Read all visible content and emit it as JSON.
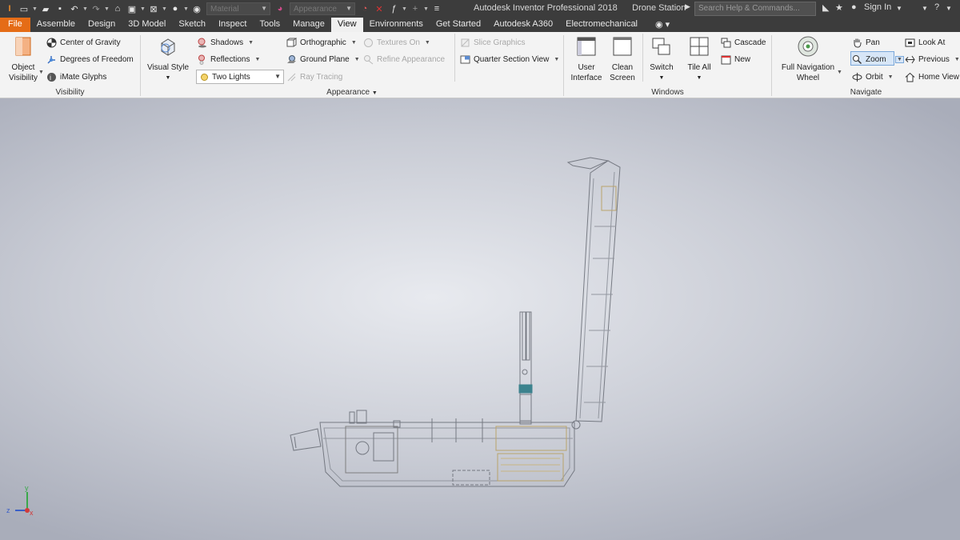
{
  "app": {
    "title": "Autodesk Inventor Professional 2018",
    "document": "Drone Station"
  },
  "qat": {
    "material_placeholder": "Material",
    "appearance_placeholder": "Appearance"
  },
  "search": {
    "placeholder": "Search Help & Commands..."
  },
  "user": {
    "sign_in": "Sign In"
  },
  "tabs": [
    "File",
    "Assemble",
    "Design",
    "3D Model",
    "Sketch",
    "Inspect",
    "Tools",
    "Manage",
    "View",
    "Environments",
    "Get Started",
    "Autodesk A360",
    "Electromechanical"
  ],
  "active_tab": "View",
  "panels": {
    "visibility": {
      "title": "Visibility",
      "object_visibility": "Object\nVisibility",
      "object_visibility_l1": "Object",
      "object_visibility_l2": "Visibility",
      "center_of_gravity": "Center of Gravity",
      "degrees_of_freedom": "Degrees of Freedom",
      "imate_glyphs": "iMate Glyphs"
    },
    "appearance": {
      "title": "Appearance",
      "visual_style": "Visual Style",
      "shadows": "Shadows",
      "reflections": "Reflections",
      "lighting": "Two Lights",
      "orthographic": "Orthographic",
      "ground_plane": "Ground Plane",
      "ray_tracing": "Ray Tracing",
      "textures_on": "Textures On",
      "refine_appearance": "Refine Appearance",
      "slice_graphics": "Slice Graphics",
      "quarter_section_view": "Quarter Section View"
    },
    "windows": {
      "title": "Windows",
      "user_interface_l1": "User",
      "user_interface_l2": "Interface",
      "clean_screen_l1": "Clean",
      "clean_screen_l2": "Screen",
      "switch": "Switch",
      "tile_all": "Tile All",
      "cascade": "Cascade",
      "new": "New"
    },
    "navigate": {
      "title": "Navigate",
      "full_nav_l1": "Full Navigation",
      "full_nav_l2": "Wheel",
      "pan": "Pan",
      "zoom": "Zoom",
      "orbit": "Orbit",
      "look_at": "Look At",
      "previous": "Previous",
      "home_view": "Home View"
    }
  },
  "triad": {
    "x": "x",
    "y": "y",
    "z": "z"
  },
  "colors": {
    "titlebar": "#3c3c3c",
    "file_tab": "#e56c16",
    "ribbon": "#f3f3f3",
    "zoom_highlight": "#d7e6f7",
    "axis_x": "#d23b3b",
    "axis_y": "#3aa84a",
    "axis_z": "#3a5fc7"
  }
}
